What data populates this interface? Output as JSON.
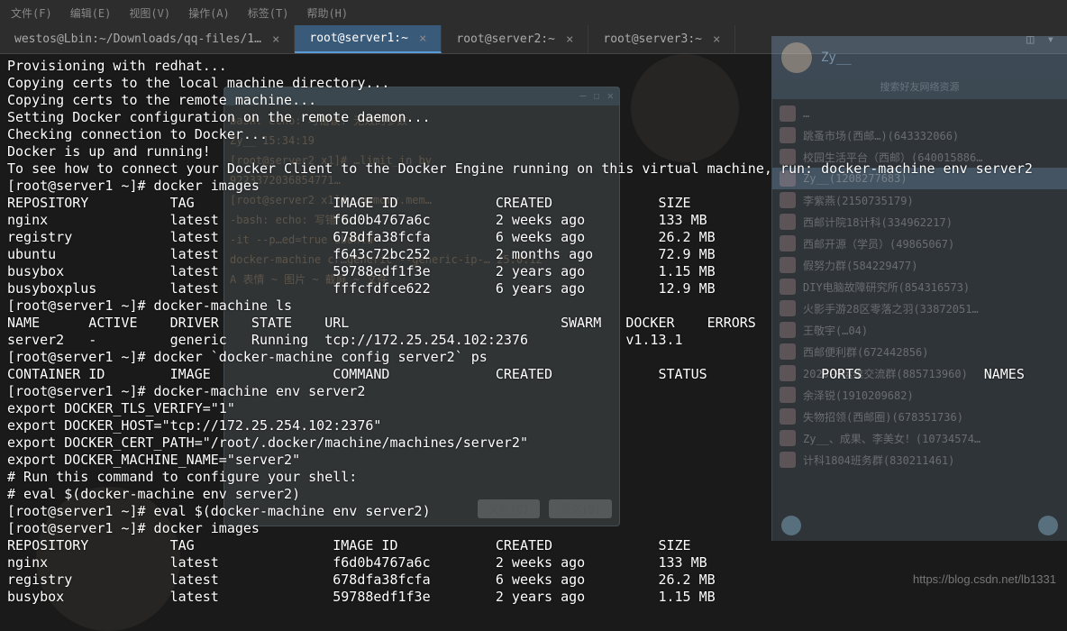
{
  "topmenu": [
    "文件(F)",
    "编辑(E)",
    "视图(V)",
    "操作(A)",
    "标签(T)",
    "帮助(H)"
  ],
  "tabs": [
    {
      "label": "westos@Lbin:~/Downloads/qq-files/1…",
      "active": false
    },
    {
      "label": "root@server1:~",
      "active": true
    },
    {
      "label": "root@server2:~",
      "active": false
    },
    {
      "label": "root@server3:~",
      "active": false
    }
  ],
  "term_lines": [
    "Provisioning with redhat...",
    "Copying certs to the local machine directory...",
    "Copying certs to the remote machine...",
    "Setting Docker configuration on the remote daemon...",
    "Checking connection to Docker...",
    "Docker is up and running!",
    "To see how to connect your Docker Client to the Docker Engine running on this virtual machine, run: docker-machine env server2",
    "[root@server1 ~]# docker images"
  ],
  "images_header": [
    "REPOSITORY",
    "TAG",
    "IMAGE ID",
    "CREATED",
    "SIZE"
  ],
  "images1": [
    {
      "repo": "nginx",
      "tag": "latest",
      "id": "f6d0b4767a6c",
      "created": "2 weeks ago",
      "size": "133 MB"
    },
    {
      "repo": "registry",
      "tag": "latest",
      "id": "678dfa38fcfa",
      "created": "6 weeks ago",
      "size": "26.2 MB"
    },
    {
      "repo": "ubuntu",
      "tag": "latest",
      "id": "f643c72bc252",
      "created": "2 months ago",
      "size": "72.9 MB"
    },
    {
      "repo": "busybox",
      "tag": "latest",
      "id": "59788edf1f3e",
      "created": "2 years ago",
      "size": "1.15 MB"
    },
    {
      "repo": "busyboxplus",
      "tag": "latest",
      "id": "fffcfdfce622",
      "created": "6 years ago",
      "size": "12.9 MB"
    }
  ],
  "dm_ls_cmd": "[root@server1 ~]# docker-machine ls",
  "dm_ls_header": [
    "NAME",
    "ACTIVE",
    "DRIVER",
    "STATE",
    "URL",
    "SWARM",
    "DOCKER",
    "ERRORS"
  ],
  "dm_ls_row": {
    "name": "server2",
    "active": "-",
    "driver": "generic",
    "state": "Running",
    "url": "tcp://172.25.254.102:2376",
    "swarm": "",
    "docker": "v1.13.1",
    "errors": ""
  },
  "config_cmd": "[root@server1 ~]# docker `docker-machine config server2` ps",
  "ps_header": [
    "CONTAINER ID",
    "IMAGE",
    "COMMAND",
    "CREATED",
    "STATUS",
    "PORTS",
    "NAMES"
  ],
  "env_cmd": "[root@server1 ~]# docker-machine env server2",
  "env_lines": [
    "export DOCKER_TLS_VERIFY=\"1\"",
    "export DOCKER_HOST=\"tcp://172.25.254.102:2376\"",
    "export DOCKER_CERT_PATH=\"/root/.docker/machine/machines/server2\"",
    "export DOCKER_MACHINE_NAME=\"server2\"",
    "# Run this command to configure your shell:",
    "# eval $(docker-machine env server2)"
  ],
  "eval_cmd": "[root@server1 ~]# eval $(docker-machine env server2)",
  "images2_cmd": "[root@server1 ~]# docker images",
  "images2": [
    {
      "repo": "nginx",
      "tag": "latest",
      "id": "f6d0b4767a6c",
      "created": "2 weeks ago",
      "size": "133 MB"
    },
    {
      "repo": "registry",
      "tag": "latest",
      "id": "678dfa38fcfa",
      "created": "6 weeks ago",
      "size": "26.2 MB"
    },
    {
      "repo": "busybox",
      "tag": "latest",
      "id": "59788edf1f3e",
      "created": "2 years ago",
      "size": "1.15 MB"
    }
  ],
  "bgwin": {
    "lines": [
      "bash: echo: 与错误: 无效的参数",
      "",
      "Zy__ 15:34:19",
      "[root@server2 x1]# …limit_in_by",
      "9223372036854771…",
      "[root@server2 x1]# …memory.mem…",
      "-bash: echo: 写错 …",
      "",
      "-it --p…ed=true ubuntu",
      "docker-machine cr…generic --generic-ip-… 25.0.12",
      "",
      "A 表情  ~ 图片  ~ 截屏  ~ 文件"
    ],
    "close_label": "关闭(C)",
    "send_label": "发送(S)"
  },
  "qq": {
    "name": "Zy__",
    "tabs_label": "搜索好友网络资源",
    "items": [
      "…",
      "跳蚤市场(西邮…)(643332066)",
      "校园生活平台（西邮）(640015886…",
      "Zy__(1208277683)",
      "李紫燕(2150735179)",
      "西邮计院18计科(334962217)",
      "西邮开源（学员）(49865067)",
      "假努力群(584229477)",
      "DIY电脑故障研究所(854316573)",
      "火影手游28区零落之羽(33872051…",
      "王敬宇(…04)",
      "西邮便利群(672442856)",
      "2020-9运维交流群(885713960)",
      "余泽锐(1910209682)",
      "失物招领(西邮圈)(678351736)",
      "Zy__、成果、李美女！(10734574…",
      "计科1804班务群(830211461)"
    ]
  },
  "watermark": "https://blog.csdn.net/lb1331"
}
